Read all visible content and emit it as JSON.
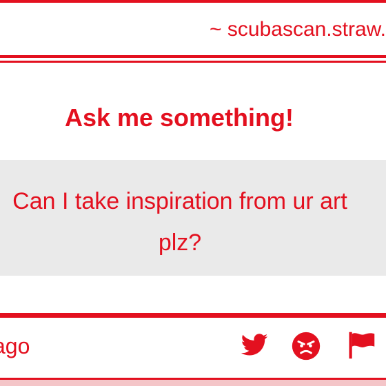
{
  "header": {
    "site_text": "~ scubascan.straw."
  },
  "card": {
    "title": "Ask me something!",
    "question_line1": "Can I take inspiration from ur art",
    "question_line2": "plz?"
  },
  "footer": {
    "time_text": "ago",
    "icons": [
      "twitter-icon",
      "angry-face-icon",
      "flag-icon"
    ]
  },
  "colors": {
    "accent": "#e3101f",
    "question_bg": "#eaeaea"
  }
}
